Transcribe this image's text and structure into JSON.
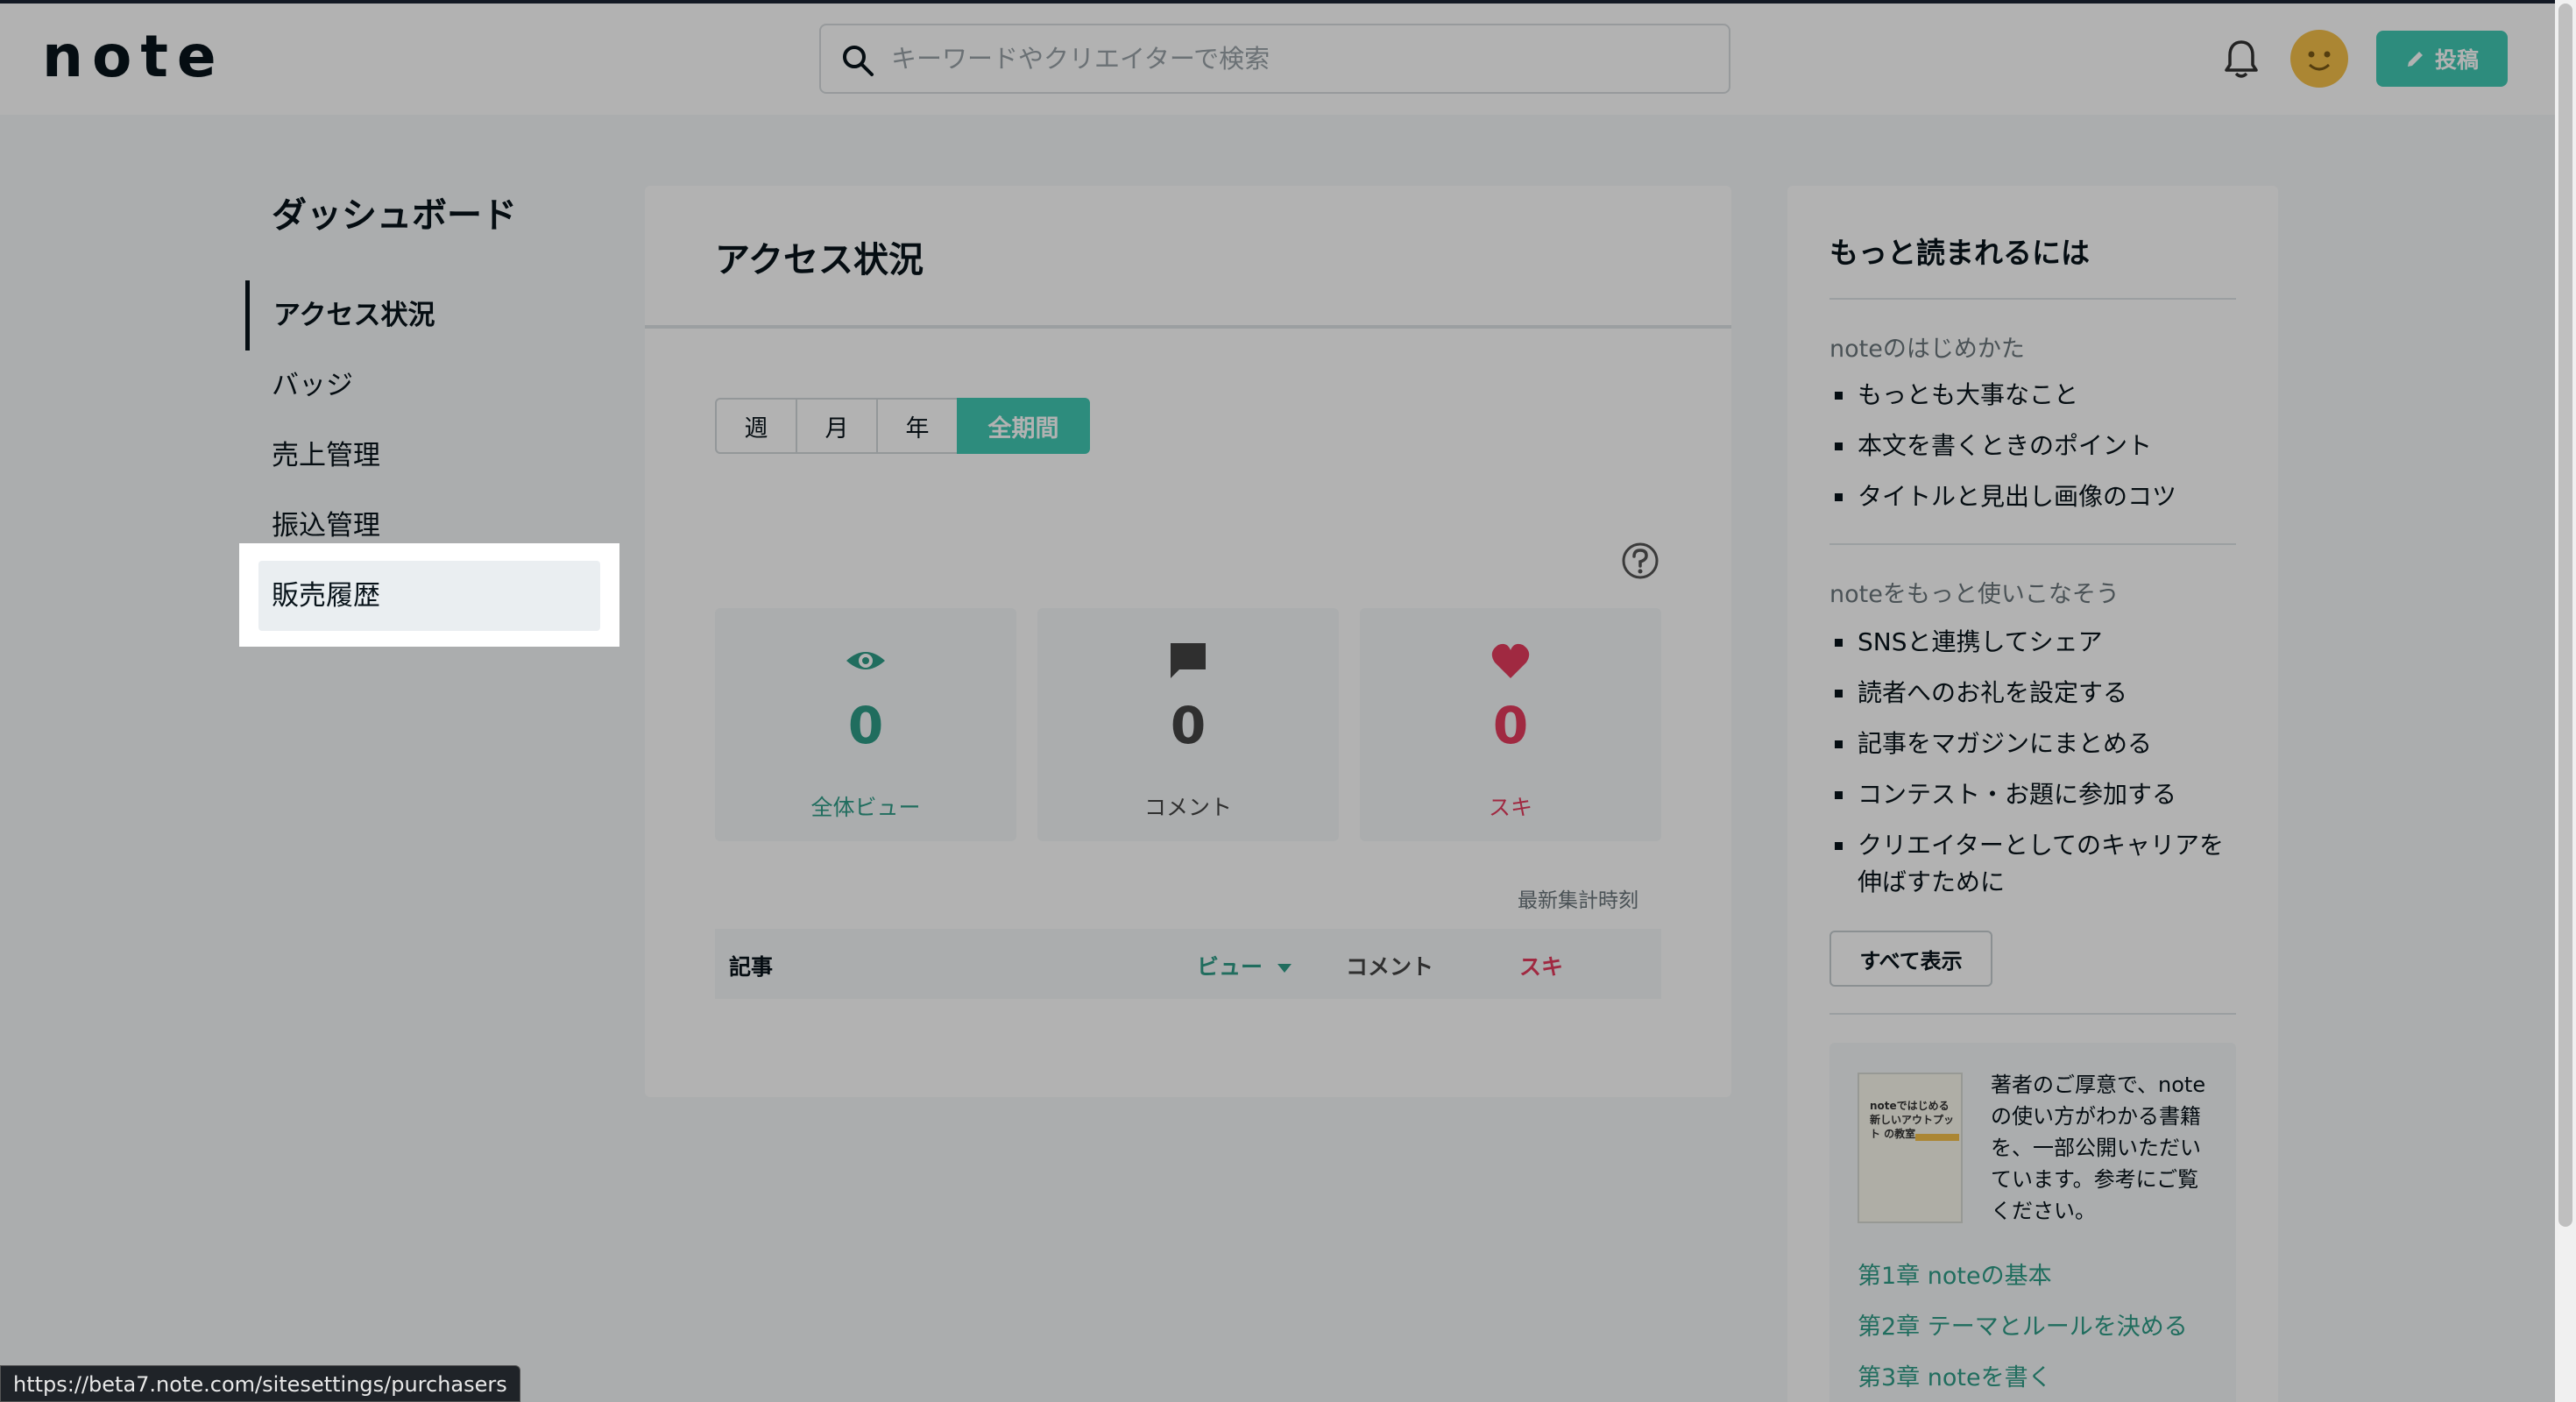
{
  "header": {
    "logo": "note",
    "search_placeholder": "キーワードやクリエイターで検索",
    "post_label": "投稿"
  },
  "sidebar": {
    "title": "ダッシュボード",
    "items": [
      {
        "label": "アクセス状況"
      },
      {
        "label": "バッジ"
      },
      {
        "label": "売上管理"
      },
      {
        "label": "振込管理"
      },
      {
        "label": "販売履歴"
      }
    ]
  },
  "main": {
    "title": "アクセス状況",
    "periods": [
      "週",
      "月",
      "年",
      "全期間"
    ],
    "active_period": "全期間",
    "stats": [
      {
        "value": "0",
        "label": "全体ビュー",
        "color": "#2e9c87"
      },
      {
        "value": "0",
        "label": "コメント",
        "color": "#444444"
      },
      {
        "value": "0",
        "label": "スキ",
        "color": "#e63b5e"
      }
    ],
    "updated_label": "最新集計時刻",
    "table_headers": {
      "article": "記事",
      "views": "ビュー",
      "comments": "コメント",
      "likes": "スキ"
    }
  },
  "right": {
    "title": "もっと読まれるには",
    "section1": {
      "heading": "noteのはじめかた",
      "items": [
        "もっとも大事なこと",
        "本文を書くときのポイント",
        "タイトルと見出し画像のコツ"
      ]
    },
    "section2": {
      "heading": "noteをもっと使いこなそう",
      "items": [
        "SNSと連携してシェア",
        "読者へのお礼を設定する",
        "記事をマガジンにまとめる",
        "コンテスト・お題に参加する",
        "クリエイターとしてのキャリアを伸ばすために"
      ]
    },
    "show_all": "すべて表示",
    "book": {
      "cover_text": "noteではじめる 新しいアウトプット の教室",
      "description": "著者のご厚意で、noteの使い方がわかる書籍を、一部公開いただいています。参考にご覧ください。",
      "chapters": [
        "第1章 noteの基本",
        "第2章 テーマとルールを決める",
        "第3章 noteを書く"
      ]
    }
  },
  "status_url": "https://beta7.note.com/sitesettings/purchasers",
  "colors": {
    "brand_green": "#41c9b4",
    "like_red": "#e63b5e"
  }
}
